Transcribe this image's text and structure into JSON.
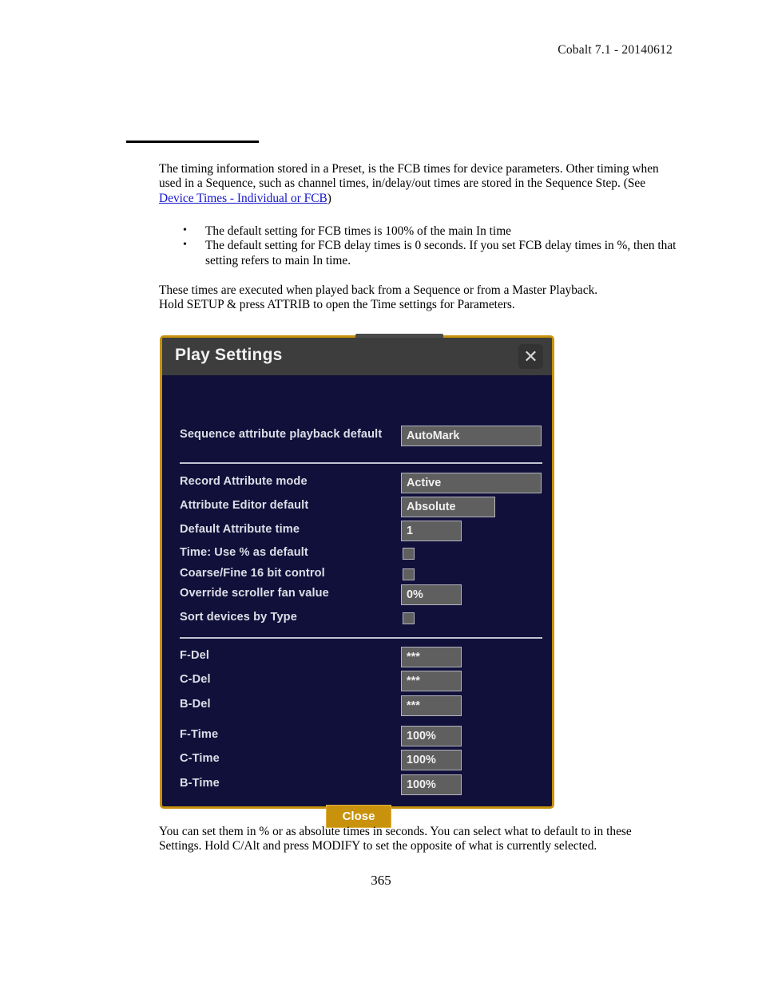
{
  "document": {
    "header": "Cobalt 7.1 - 20140612",
    "page_number": "365",
    "intro_paragraph_part1": "The timing information stored in a Preset, is the FCB times for device parameters. Other timing when used in a Sequence, such as channel times, in/delay/out times are stored in the Sequence Step. (See ",
    "intro_link": "Device Times - Individual or FCB",
    "intro_paragraph_part2": ")",
    "bullets": [
      "The default setting for FCB times is 100% of the main In time",
      "The default setting for FCB delay times is 0 seconds. If you set FCB delay times in %, then that setting refers to main In time."
    ],
    "mid_paragraph_line1": "These times are executed when played back from a Sequence or from a Master Playback.",
    "mid_paragraph_line2": "Hold SETUP & press ATTRIB to open the Time settings for Parameters.",
    "end_paragraph_line1": "You can set them in % or as absolute times in seconds. You can select what to default to in these",
    "end_paragraph_line2": "Settings. Hold C/Alt and press MODIFY to set the opposite of what is currently selected."
  },
  "dialog": {
    "title": "Play Settings",
    "close_icon": "close-icon",
    "close_icon_glyph": "✕",
    "colors": {
      "border": "#c8920c",
      "titlebar": "#3d3d3d",
      "body": "#10103a",
      "field": "#5f5f5f",
      "field_border": "#b4b4c0",
      "button": "#c8920c",
      "divider": "#c3c3d2"
    },
    "section_top": {
      "rows": [
        {
          "label": "Sequence attribute playback default",
          "type": "field",
          "value": "AutoMark"
        }
      ]
    },
    "section_middle": {
      "rows": [
        {
          "label": "Record Attribute mode",
          "type": "field",
          "value": "Active"
        },
        {
          "label": "Attribute Editor default",
          "type": "field",
          "value": "Absolute"
        },
        {
          "label": "Default Attribute time",
          "type": "field",
          "value": "1"
        },
        {
          "label": "Time: Use % as default",
          "type": "checkbox",
          "value": ""
        },
        {
          "label": "Coarse/Fine 16 bit control",
          "type": "checkbox",
          "value": ""
        },
        {
          "label": "Override scroller fan value",
          "type": "field",
          "value": "0%"
        },
        {
          "label": "Sort devices by Type",
          "type": "checkbox",
          "value": ""
        }
      ]
    },
    "section_bottom": {
      "rows": [
        {
          "label": "F-Del",
          "type": "field",
          "value": "***"
        },
        {
          "label": "C-Del",
          "type": "field",
          "value": "***"
        },
        {
          "label": "B-Del",
          "type": "field",
          "value": "***"
        },
        {
          "label": "F-Time",
          "type": "field",
          "value": "100%"
        },
        {
          "label": "C-Time",
          "type": "field",
          "value": "100%"
        },
        {
          "label": "B-Time",
          "type": "field",
          "value": "100%"
        }
      ]
    },
    "close_button_label": "Close"
  }
}
